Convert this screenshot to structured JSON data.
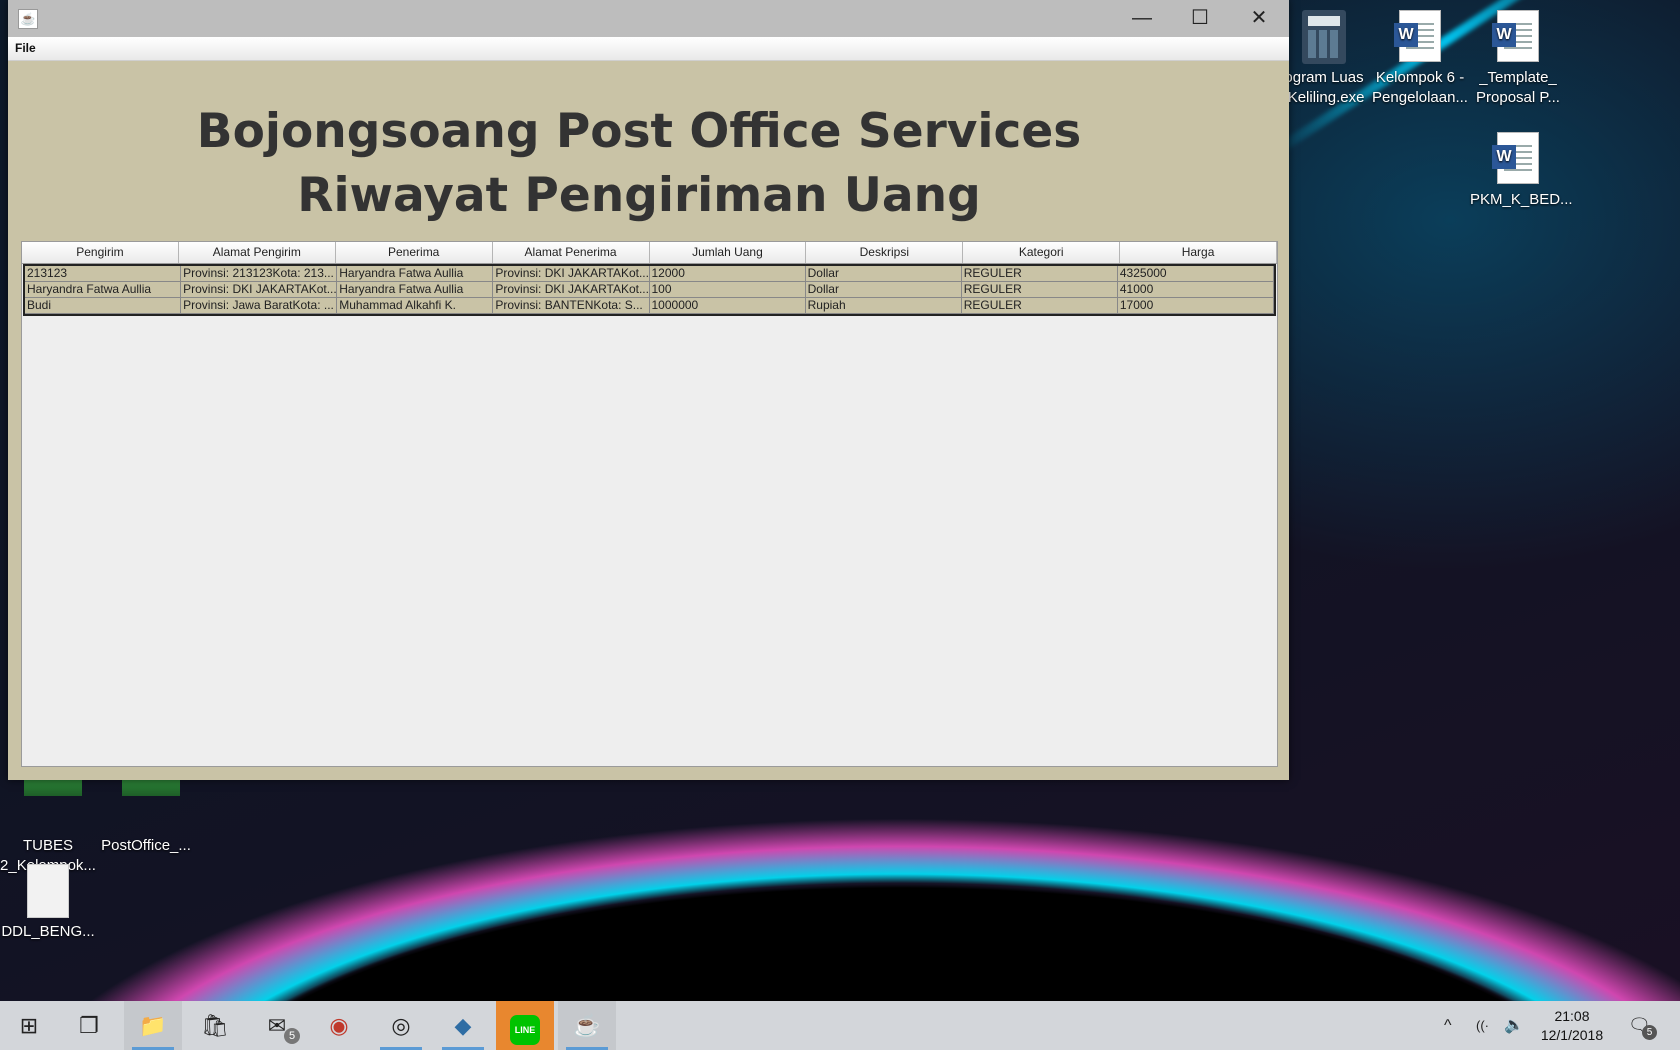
{
  "desktop": {
    "icons": [
      {
        "label": "ogram Luas\n Keliling.exe",
        "icon": "calculator-icon"
      },
      {
        "label": "Kelompok 6 -\nPengelolaan...",
        "icon": "word-document-icon"
      },
      {
        "label": "_Template_\nProposal P...",
        "icon": "word-document-icon"
      },
      {
        "label": "PKM_K_BED...",
        "icon": "word-document-icon"
      },
      {
        "label": "TUBES\n2_Kelompok...",
        "icon": "rar-archive-icon"
      },
      {
        "label": "PostOffice_...",
        "icon": "rar-archive-icon"
      },
      {
        "label": "DDL_BENG...",
        "icon": "blank-file-icon"
      }
    ]
  },
  "window": {
    "app_icon": "java-icon",
    "controls": {
      "minimize": "—",
      "maximize": "☐",
      "close": "✕"
    },
    "menu": {
      "file": "File"
    },
    "title_line1": "Bojongsoang Post Office Services",
    "title_line2": "Riwayat Pengiriman Uang"
  },
  "table": {
    "columns": [
      "Pengirim",
      "Alamat Pengirim",
      "Penerima",
      "Alamat Penerima",
      "Jumlah Uang",
      "Deskripsi",
      "Kategori",
      "Harga"
    ],
    "rows": [
      [
        "213123",
        "Provinsi: 213123Kota: 213...",
        "Haryandra Fatwa Aullia",
        "Provinsi: DKI JAKARTAKot...",
        "12000",
        "Dollar",
        "REGULER",
        "4325000"
      ],
      [
        "Haryandra Fatwa Aullia",
        "Provinsi: DKI JAKARTAKot...",
        "Haryandra Fatwa Aullia",
        "Provinsi: DKI JAKARTAKot...",
        "100",
        "Dollar",
        "REGULER",
        "41000"
      ],
      [
        "Budi",
        "Provinsi: Jawa BaratKota: ...",
        "Muhammad Alkahfi K.",
        "Provinsi: BANTENKota: S...",
        "1000000",
        "Rupiah",
        "REGULER",
        "17000"
      ]
    ]
  },
  "taskbar": {
    "items": [
      {
        "icon": "windows-start-icon",
        "glyph": "⊞"
      },
      {
        "icon": "task-view-icon",
        "glyph": "❐"
      },
      {
        "icon": "file-explorer-icon",
        "glyph": "📁"
      },
      {
        "icon": "store-icon",
        "glyph": "🛍"
      },
      {
        "icon": "mail-icon",
        "glyph": "✉",
        "badge": "5"
      },
      {
        "icon": "game-app-icon",
        "glyph": "◉"
      },
      {
        "icon": "chrome-icon",
        "glyph": "◎"
      },
      {
        "icon": "virtualbox-icon",
        "glyph": "◆"
      },
      {
        "icon": "line-icon",
        "glyph": "LINE"
      },
      {
        "icon": "java-icon",
        "glyph": "☕"
      }
    ],
    "tray": {
      "chevron": "^",
      "network": "((·",
      "volume": "🔈",
      "time": "21:08",
      "date": "12/1/2018",
      "notifications_badge": "5"
    }
  }
}
